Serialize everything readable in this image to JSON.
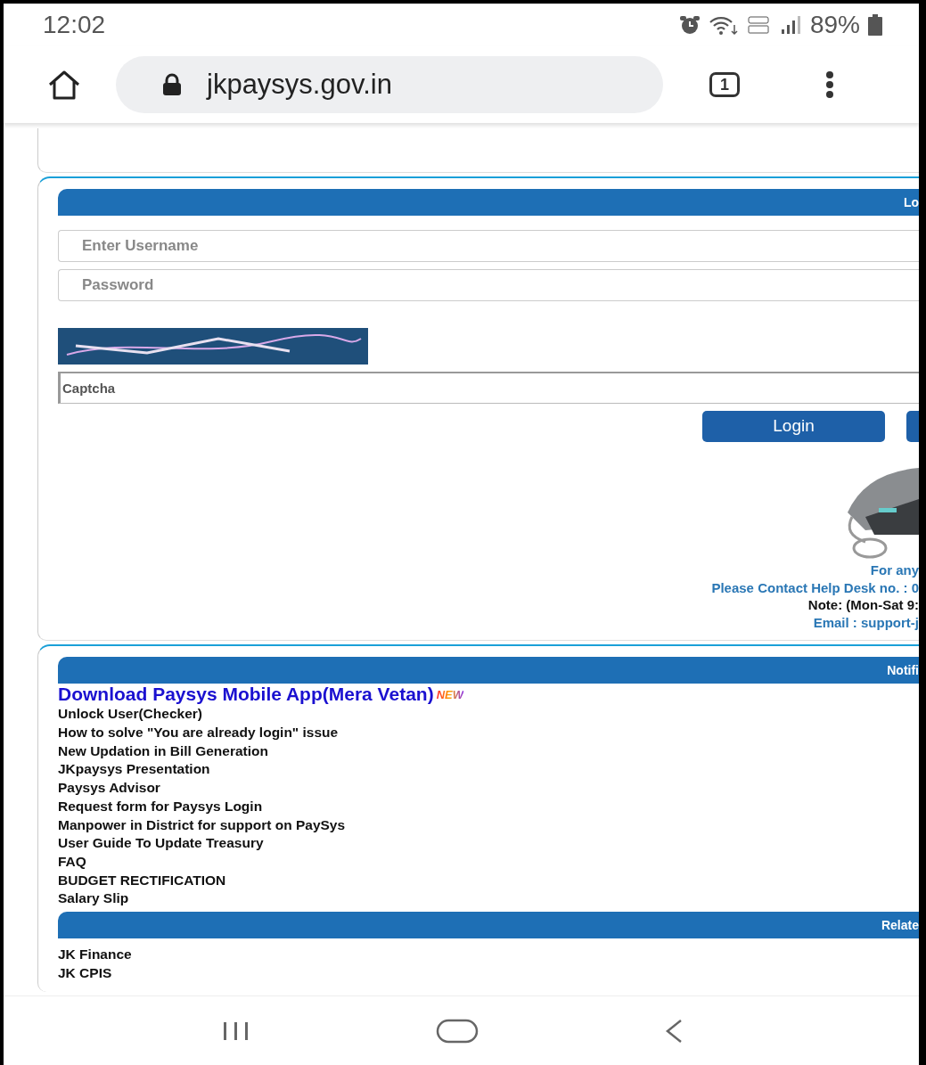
{
  "status_bar": {
    "time": "12:02",
    "battery": "89%"
  },
  "browser": {
    "url": "jkpaysys.gov.in",
    "tab_count": "1"
  },
  "login_panel": {
    "header": "Lo",
    "username": {
      "placeholder": "Enter Username"
    },
    "password": {
      "placeholder": "Password"
    },
    "captcha": {
      "placeholder": "Captcha"
    },
    "buttons": [
      "Login"
    ]
  },
  "help": {
    "lines": [
      {
        "text": "For any",
        "kind": "info"
      },
      {
        "text": "Please Contact Help Desk no. : 0",
        "kind": "info"
      },
      {
        "text": "Note: (Mon-Sat 9:",
        "kind": "note"
      },
      {
        "text": "Email : support-j",
        "kind": "info"
      }
    ]
  },
  "notifications": {
    "header": "Notifi",
    "items": [
      {
        "text": "Download Paysys Mobile App(Mera Vetan)",
        "kind": "featured",
        "badge": "NEW"
      },
      {
        "text": "Unlock User(Checker)",
        "kind": "plain"
      },
      {
        "text": "How to solve \"You are already login\" issue",
        "kind": "plain"
      },
      {
        "text": "New Updation in Bill Generation",
        "kind": "plain"
      },
      {
        "text": "JKpaysys Presentation",
        "kind": "plain"
      },
      {
        "text": "Paysys Advisor",
        "kind": "plain"
      },
      {
        "text": "Request form for Paysys Login",
        "kind": "plain"
      },
      {
        "text": "Manpower in District for support on PaySys",
        "kind": "plain"
      },
      {
        "text": "User Guide To Update Treasury",
        "kind": "plain"
      },
      {
        "text": "FAQ",
        "kind": "plain"
      },
      {
        "text": "BUDGET RECTIFICATION",
        "kind": "plain"
      },
      {
        "text": "Salary Slip",
        "kind": "plain"
      }
    ]
  },
  "related": {
    "header": "Relate",
    "items": [
      {
        "text": "JK Finance"
      },
      {
        "text": "JK CPIS"
      }
    ]
  }
}
